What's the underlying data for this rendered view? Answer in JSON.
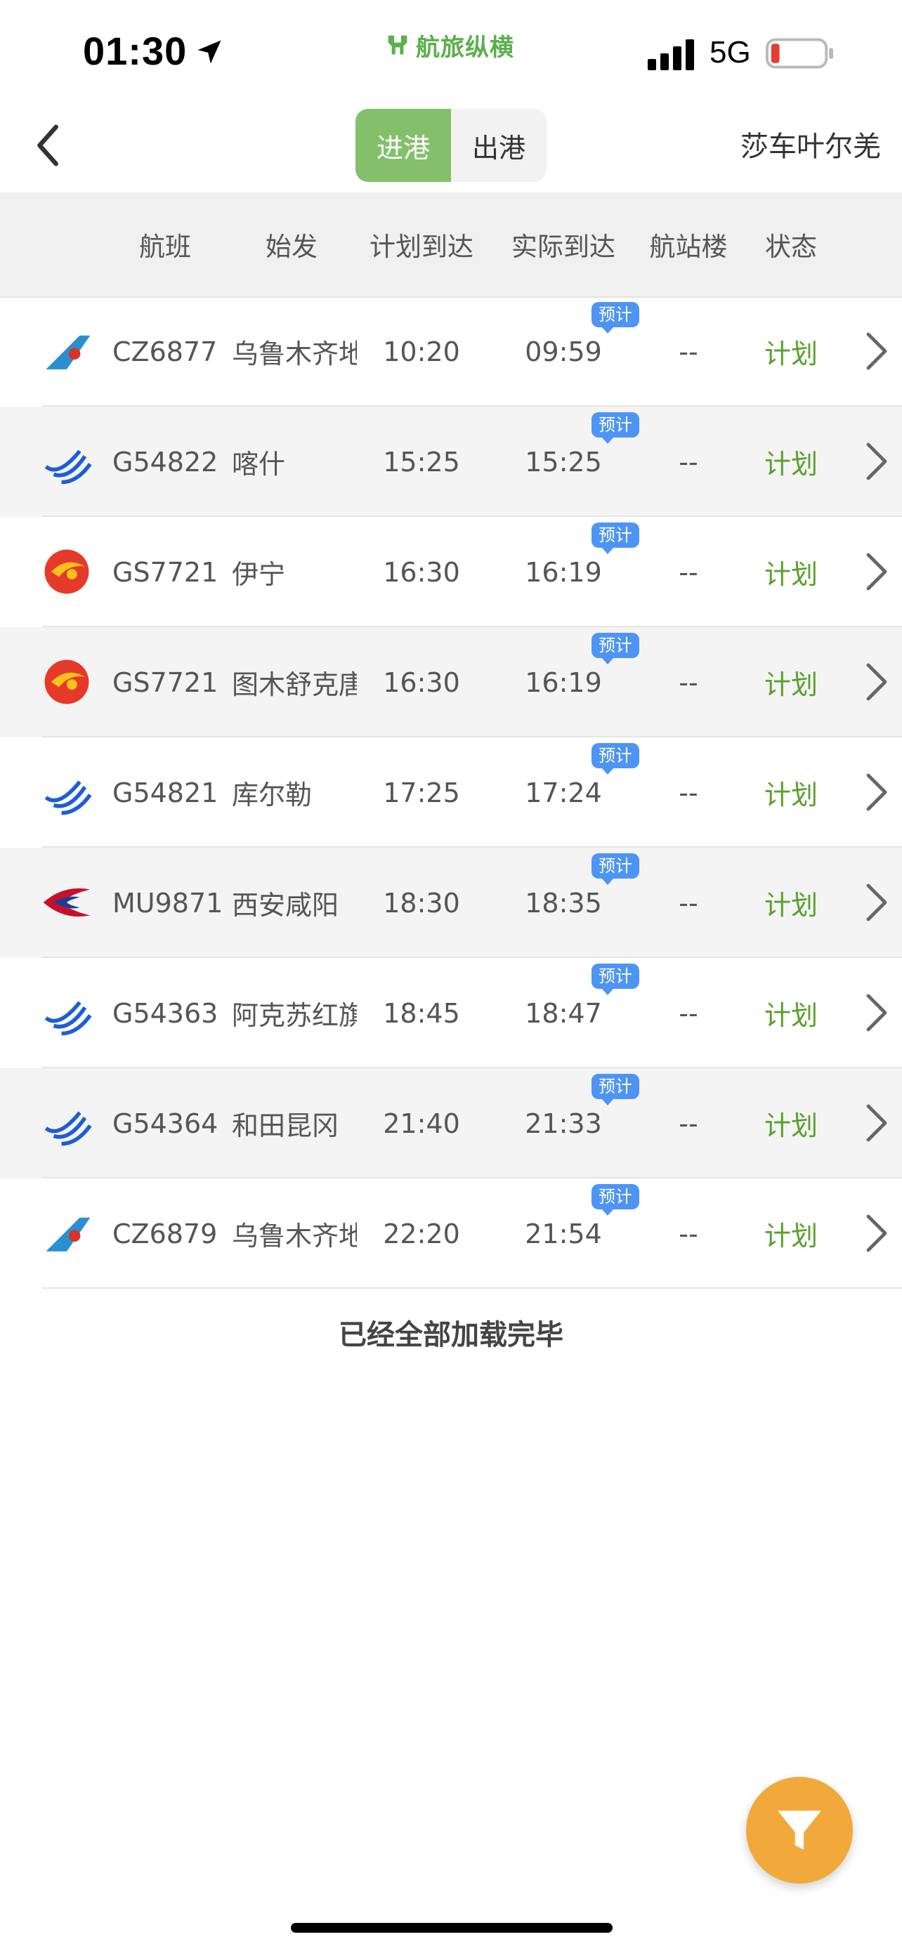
{
  "status_bar": {
    "time": "01:30",
    "brand": "航旅纵横",
    "network": "5G"
  },
  "nav": {
    "tabs": [
      {
        "label": "进港",
        "active": true
      },
      {
        "label": "出港",
        "active": false
      }
    ],
    "airport": "莎车叶尔羌",
    "accent_color": "#84c06a"
  },
  "table": {
    "columns": [
      "航班",
      "始发",
      "计划到达",
      "实际到达",
      "航站楼",
      "状态"
    ],
    "estimate_badge": "预计",
    "rows": [
      {
        "airline_icon": "china-southern-icon",
        "flight": "CZ6877",
        "origin": "乌鲁木齐地",
        "scheduled": "10:20",
        "actual": "09:59",
        "terminal": "--",
        "status": "计划"
      },
      {
        "airline_icon": "loong-air-icon",
        "flight": "G54822",
        "origin": "喀什",
        "scheduled": "15:25",
        "actual": "15:25",
        "terminal": "--",
        "status": "计划"
      },
      {
        "airline_icon": "tianjin-airlines-icon",
        "flight": "GS7721",
        "origin": "伊宁",
        "scheduled": "16:30",
        "actual": "16:19",
        "terminal": "--",
        "status": "计划"
      },
      {
        "airline_icon": "tianjin-airlines-icon",
        "flight": "GS7721",
        "origin": "图木舒克唐",
        "scheduled": "16:30",
        "actual": "16:19",
        "terminal": "--",
        "status": "计划"
      },
      {
        "airline_icon": "loong-air-icon",
        "flight": "G54821",
        "origin": "库尔勒",
        "scheduled": "17:25",
        "actual": "17:24",
        "terminal": "--",
        "status": "计划"
      },
      {
        "airline_icon": "china-eastern-icon",
        "flight": "MU9871",
        "origin": "西安咸阳",
        "scheduled": "18:30",
        "actual": "18:35",
        "terminal": "--",
        "status": "计划"
      },
      {
        "airline_icon": "loong-air-icon",
        "flight": "G54363",
        "origin": "阿克苏红旗",
        "scheduled": "18:45",
        "actual": "18:47",
        "terminal": "--",
        "status": "计划"
      },
      {
        "airline_icon": "loong-air-icon",
        "flight": "G54364",
        "origin": "和田昆冈",
        "scheduled": "21:40",
        "actual": "21:33",
        "terminal": "--",
        "status": "计划"
      },
      {
        "airline_icon": "china-southern-icon",
        "flight": "CZ6879",
        "origin": "乌鲁木齐地",
        "scheduled": "22:20",
        "actual": "21:54",
        "terminal": "--",
        "status": "计划"
      }
    ]
  },
  "footer_text": "已经全部加载完毕",
  "colors": {
    "status_green": "#5aa02c",
    "badge_blue": "#4d94f5",
    "filter_orange": "#f2a93b"
  }
}
